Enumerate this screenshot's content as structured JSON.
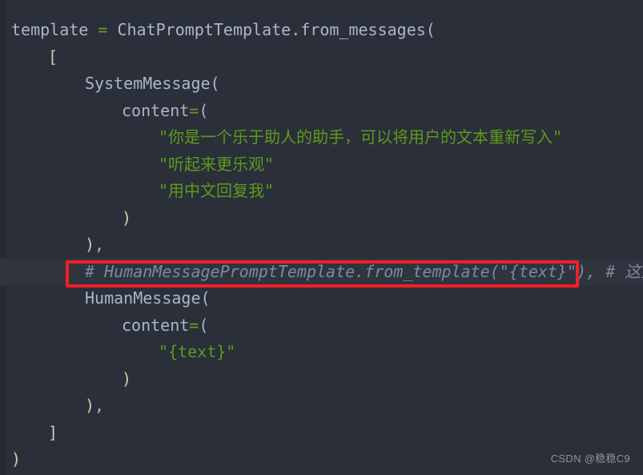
{
  "editor": {
    "background_color": "#2b2f3a",
    "gutter_color": "#262a33",
    "highlight_color": "#30343f",
    "colors": {
      "plain": "#a9b7c6",
      "operator": "#6a9b20",
      "string": "#5c9b1b",
      "bracket": "#d6c9a8",
      "comment": "#7e8a99",
      "annotation_red": "#f01f28"
    },
    "lines": [
      {
        "indent": 0,
        "tokens": [
          {
            "text": "template ",
            "type": "ident"
          },
          {
            "text": "=",
            "type": "op"
          },
          {
            "text": " ChatPromptTemplate.from_messages(",
            "type": "plain"
          }
        ]
      },
      {
        "indent": 1,
        "tokens": [
          {
            "text": "[",
            "type": "bracket"
          }
        ]
      },
      {
        "indent": 2,
        "tokens": [
          {
            "text": "SystemMessage(",
            "type": "plain"
          }
        ]
      },
      {
        "indent": 3,
        "tokens": [
          {
            "text": "content",
            "type": "plain"
          },
          {
            "text": "=",
            "type": "op"
          },
          {
            "text": "(",
            "type": "plain"
          }
        ]
      },
      {
        "indent": 4,
        "tokens": [
          {
            "text": "\"你是一个乐于助人的助手，可以将用户的文本重新写入\"",
            "type": "str"
          }
        ]
      },
      {
        "indent": 4,
        "tokens": [
          {
            "text": "\"听起来更乐观\"",
            "type": "str"
          }
        ]
      },
      {
        "indent": 4,
        "tokens": [
          {
            "text": "\"用中文回复我\"",
            "type": "str"
          }
        ]
      },
      {
        "indent": 3,
        "tokens": [
          {
            "text": ")",
            "type": "bracket"
          }
        ]
      },
      {
        "indent": 2,
        "tokens": [
          {
            "text": ")",
            "type": "bracket"
          },
          {
            "text": ",",
            "type": "comma"
          }
        ]
      },
      {
        "indent": 2,
        "highlighted": true,
        "tokens": [
          {
            "text": "# HumanMessagePromptTemplate.from_template(\"{text}\"), # 这里",
            "type": "comment"
          }
        ]
      },
      {
        "indent": 2,
        "tokens": [
          {
            "text": "HumanMessage(",
            "type": "plain"
          }
        ]
      },
      {
        "indent": 3,
        "tokens": [
          {
            "text": "content",
            "type": "plain"
          },
          {
            "text": "=",
            "type": "op"
          },
          {
            "text": "(",
            "type": "plain"
          }
        ]
      },
      {
        "indent": 4,
        "tokens": [
          {
            "text": "\"{text}\"",
            "type": "str"
          }
        ]
      },
      {
        "indent": 3,
        "tokens": [
          {
            "text": ")",
            "type": "bracket"
          }
        ]
      },
      {
        "indent": 2,
        "tokens": [
          {
            "text": ")",
            "type": "bracket"
          },
          {
            "text": ",",
            "type": "comma"
          }
        ]
      },
      {
        "indent": 1,
        "tokens": [
          {
            "text": "]",
            "type": "bracket"
          }
        ]
      },
      {
        "indent": 0,
        "tokens": [
          {
            "text": ")",
            "type": "bracket"
          }
        ]
      }
    ]
  },
  "annotation": {
    "shape": "rectangle",
    "target_line_index": 9,
    "color": "#f01f28"
  },
  "watermark": {
    "text": "CSDN @稳稳C9"
  }
}
